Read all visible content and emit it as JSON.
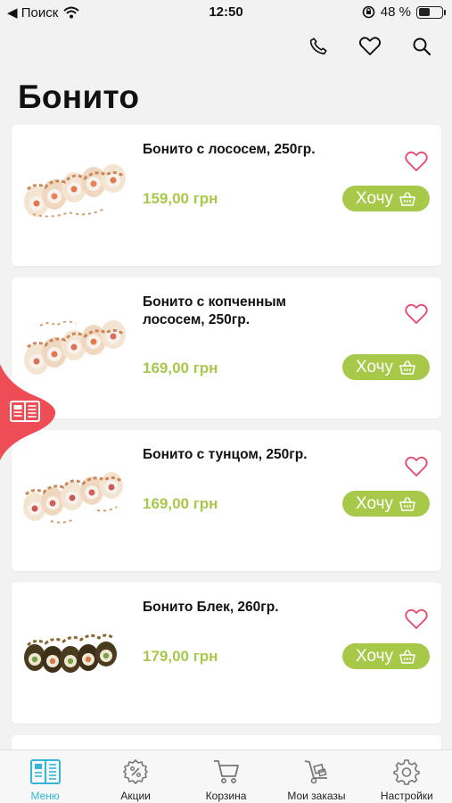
{
  "status_bar": {
    "back_label": "◀ Поиск",
    "time": "12:50",
    "battery_percent": "48 %",
    "battery_level": 0.48
  },
  "page": {
    "title": "Бонито"
  },
  "accent_colors": {
    "price": "#a8c84a",
    "button": "#a8c84a",
    "favorite": "#e8456c",
    "side_tab": "#ef4d56",
    "nav_active": "#35b6d8"
  },
  "products": [
    {
      "name": "Бонито с лососем, 250гр.",
      "price": "159,00 грн",
      "button_label": "Хочу"
    },
    {
      "name": "Бонито с копченным лососем, 250гр.",
      "price": "169,00 грн",
      "button_label": "Хочу"
    },
    {
      "name": "Бонито с тунцом, 250гр.",
      "price": "169,00 грн",
      "button_label": "Хочу"
    },
    {
      "name": "Бонито Блек, 260гр.",
      "price": "179,00 грн",
      "button_label": "Хочу"
    }
  ],
  "bottom_nav": [
    {
      "label": "Меню",
      "icon": "menu-book-icon",
      "active": true
    },
    {
      "label": "Акции",
      "icon": "percent-badge-icon"
    },
    {
      "label": "Корзина",
      "icon": "cart-icon"
    },
    {
      "label": "Мои заказы",
      "icon": "hand-truck-icon"
    },
    {
      "label": "Настройки",
      "icon": "gear-icon"
    }
  ]
}
